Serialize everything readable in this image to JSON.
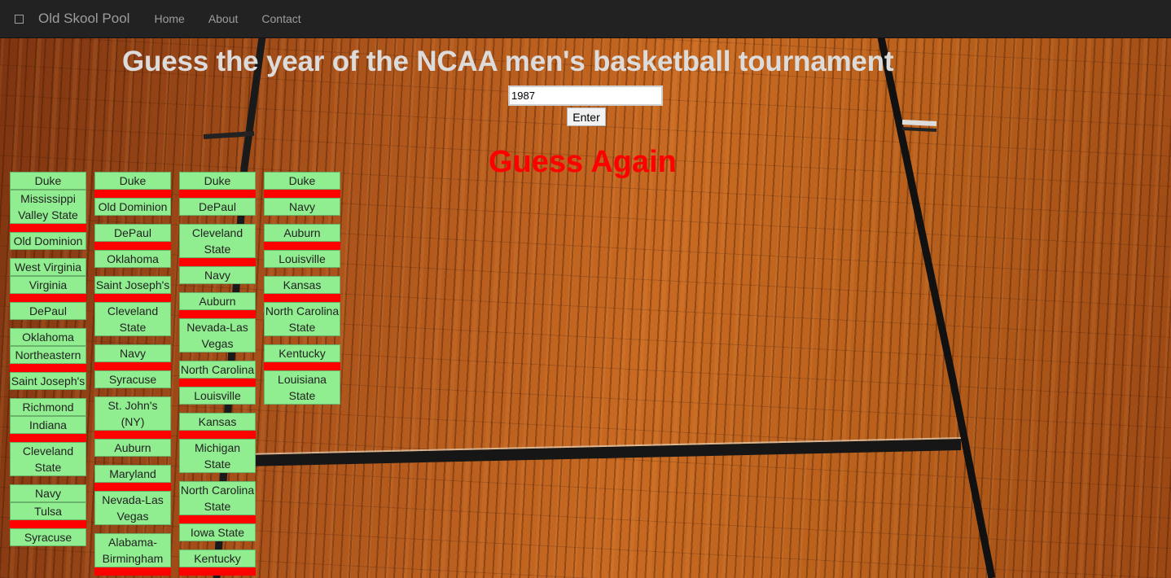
{
  "navbar": {
    "brand": "Old Skool Pool",
    "links": [
      "Home",
      "About",
      "Contact"
    ]
  },
  "title": "Guess the year of the NCAA men's basketball tournament",
  "form": {
    "year_value": "1987",
    "enter_label": "Enter"
  },
  "feedback": "Guess Again",
  "colors": {
    "team_bg": "#90ee90",
    "separator": "#ff0000",
    "feedback": "#ff0000",
    "navbar_bg": "#222222"
  },
  "bracket": {
    "rounds": [
      {
        "teams": [
          "Duke",
          "Mississippi Valley State",
          "Old Dominion",
          "West Virginia",
          "Virginia",
          "DePaul",
          "Oklahoma",
          "Northeastern",
          "Saint Joseph's",
          "Richmond",
          "Indiana",
          "Cleveland State",
          "Navy",
          "Tulsa",
          "Syracuse"
        ],
        "pattern": [
          "",
          "sep",
          "gap",
          "",
          "sep",
          "gap",
          "",
          "sep",
          "gap",
          "",
          "sep",
          "gap",
          "",
          "sep",
          "gap"
        ]
      },
      {
        "teams": [
          "Duke",
          "Old Dominion",
          "DePaul",
          "Oklahoma",
          "Saint Joseph's",
          "Cleveland State",
          "Navy",
          "Syracuse",
          "St. John's (NY)",
          "Auburn",
          "Maryland",
          "Nevada-Las Vegas",
          "Alabama-Birmingham"
        ],
        "pattern": [
          "sep",
          "gap",
          "sep",
          "gap",
          "sep",
          "gap",
          "sep",
          "gap",
          "sep",
          "gap",
          "sep",
          "gap",
          "sep"
        ]
      },
      {
        "teams": [
          "Duke",
          "DePaul",
          "Cleveland State",
          "Navy",
          "Auburn",
          "Nevada-Las Vegas",
          "North Carolina",
          "Louisville",
          "Kansas",
          "Michigan State",
          "North Carolina State",
          "Iowa State",
          "Kentucky"
        ],
        "pattern": [
          "sep",
          "gap",
          "sep",
          "gap",
          "sep",
          "gap",
          "sep",
          "gap",
          "sep",
          "gap",
          "sep",
          "gap",
          "sep"
        ]
      },
      {
        "teams": [
          "Duke",
          "Navy",
          "Auburn",
          "Louisville",
          "Kansas",
          "North Carolina State",
          "Kentucky",
          "Louisiana State"
        ],
        "pattern": [
          "sep",
          "gap",
          "sep",
          "gap",
          "sep",
          "gap",
          "sep",
          "gap"
        ]
      }
    ]
  }
}
